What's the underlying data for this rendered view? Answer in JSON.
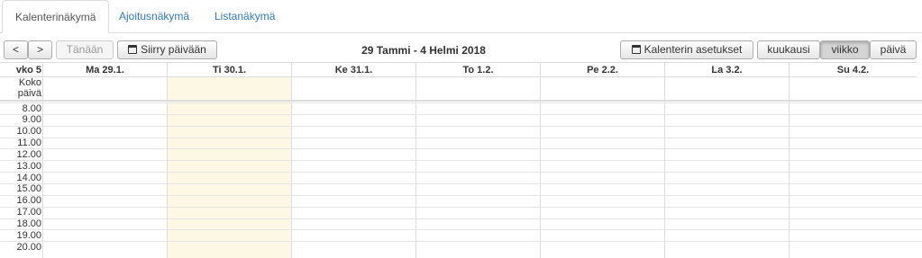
{
  "tabs": [
    "Kalenterinäkymä",
    "Ajoitusnäkymä",
    "Listanäkymä"
  ],
  "toolbar": {
    "prev": "<",
    "next": ">",
    "today": "Tänään",
    "goto": "Siirry päivään",
    "title": "29 Tammi - 4 Helmi 2018",
    "settings": "Kalenterin asetukset",
    "month": "kuukausi",
    "week": "viikko",
    "day": "päivä"
  },
  "calendar": {
    "week_label": "vko 5",
    "allday_line1": "Koko",
    "allday_line2": "päivä",
    "days": [
      "Ma 29.1.",
      "Ti 30.1.",
      "Ke 31.1.",
      "To 1.2.",
      "Pe 2.2.",
      "La 3.2.",
      "Su 4.2."
    ],
    "today_index": 1,
    "hours": [
      "8.00",
      "9.00",
      "10.00",
      "11.00",
      "12.00",
      "13.00",
      "14.00",
      "15.00",
      "16.00",
      "17.00",
      "18.00",
      "19.00",
      "20.00"
    ]
  },
  "colors": {
    "today_bg": "#fcf8e3",
    "link": "#337ab7"
  }
}
